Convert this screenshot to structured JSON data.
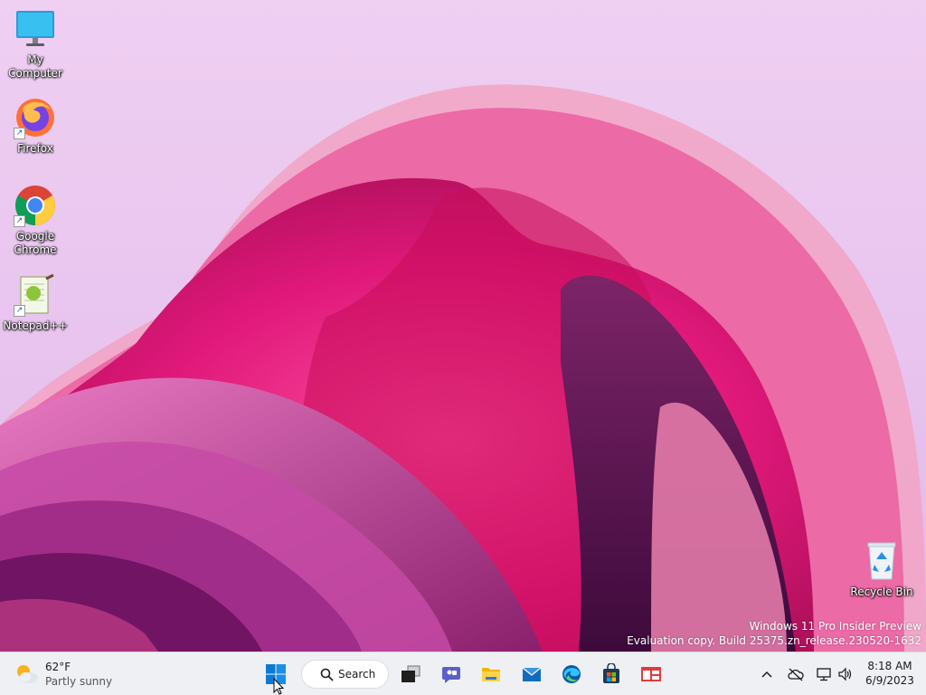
{
  "desktop": {
    "icons": [
      {
        "label": "My Computer",
        "icon": "monitor-icon"
      },
      {
        "label": "Firefox",
        "icon": "firefox-icon"
      },
      {
        "label": "Google Chrome",
        "icon": "chrome-icon"
      },
      {
        "label": "Notepad++",
        "icon": "notepadpp-icon"
      },
      {
        "label": "Recycle Bin",
        "icon": "recycle-bin-icon"
      }
    ],
    "watermark": {
      "line1": "Windows 11 Pro Insider Preview",
      "line2": "Evaluation copy. Build 25375.zn_release.230520-1632"
    }
  },
  "taskbar": {
    "weather": {
      "temp": "62°F",
      "condition": "Partly sunny",
      "icon": "partly-sunny-icon"
    },
    "search_label": "Search",
    "pinned": [
      {
        "name": "start-button",
        "icon": "windows-logo-icon"
      },
      {
        "name": "task-view-button",
        "icon": "task-view-icon"
      },
      {
        "name": "chat-button",
        "icon": "teams-chat-icon"
      },
      {
        "name": "file-explorer-button",
        "icon": "folder-icon"
      },
      {
        "name": "mail-button",
        "icon": "mail-icon"
      },
      {
        "name": "edge-button",
        "icon": "edge-icon"
      },
      {
        "name": "store-button",
        "icon": "store-icon"
      },
      {
        "name": "app-button",
        "icon": "app-window-icon"
      }
    ],
    "tray": {
      "icons": [
        "chevron-up-icon",
        "onedrive-offline-icon",
        "network-icon",
        "volume-icon"
      ],
      "time": "8:18 AM",
      "date": "6/9/2023"
    }
  },
  "colors": {
    "taskbar_bg": "#eef0f4",
    "wallpaper_bg": "#ecc9f0",
    "accent_blue": "#0078d4"
  }
}
